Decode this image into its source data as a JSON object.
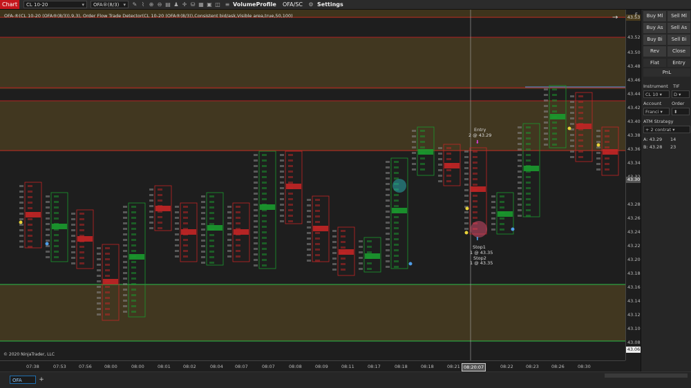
{
  "topbar": {
    "chart_tab": "Chart",
    "instrument": "CL 10-20",
    "period": "OFA®(8/3)",
    "volume_profile": "VolumeProfile",
    "ofa_sc": "OFA/SC",
    "settings": "Settings"
  },
  "chart": {
    "indicator_label": "OFA-®(CL 10-20 (OFA®(8/3)),9,3), Order Flow Trade Detector(CL 10-20 (OFA®(8/3)),Consistent bid/ask,Visible area,true,50,100)",
    "copyright": "© 2020 NinjaTrader, LLC",
    "entry_label": "Entry",
    "entry_value": "2 @ 43.29",
    "stop1_label": "Stop1",
    "stop1_value": "1 @ 43.35",
    "stop2_label": "Stop2",
    "stop2_value": "1 @ 43.35",
    "cursor_time": "08:20:07",
    "colors": {
      "bull": "#1a9b2e",
      "bear": "#c42525",
      "zone": "#4a3c1c",
      "zone_border": "#b22222",
      "green_line": "#2bbf4a",
      "blue_line": "#4f9de8"
    }
  },
  "price_axis": {
    "labels": [
      "43.52",
      "43.50",
      "43.48",
      "43.46",
      "43.44",
      "43.42",
      "43.40",
      "43.38",
      "43.36",
      "43.34",
      "43.32",
      "43.28",
      "43.26",
      "43.24",
      "43.22",
      "43.20",
      "43.18",
      "43.16",
      "43.14",
      "43.12",
      "43.10",
      "43.08"
    ],
    "current_price": "43.30",
    "top_price": "43.53",
    "bottom_price": "43.06"
  },
  "time_axis": {
    "labels": [
      "07:38",
      "07:53",
      "07:56",
      "08:00",
      "08:00",
      "08:01",
      "08:02",
      "08:04",
      "08:07",
      "08:07",
      "08:08",
      "08:09",
      "08:11",
      "08:17",
      "08:18",
      "08:18",
      "08:21",
      "08:22",
      "08:23",
      "08:26",
      "08:30"
    ]
  },
  "bottom": {
    "tab": "OFA",
    "add": "+"
  },
  "panel": {
    "buy_mkt": "Buy Ml",
    "sell_mkt": "Sell Ml",
    "buy_ask": "Buy As",
    "sell_ask": "Sell As",
    "buy_bid": "Buy Bi",
    "sell_bid": "Sell Bi",
    "rev": "Rev",
    "close": "Close",
    "flat": "Flat",
    "entry": "Entry",
    "pnl": "PnL",
    "instrument_label": "Instrument",
    "tif_label": "TIF",
    "instrument_value": "CL 10",
    "tif_value": "D",
    "account_label": "Account",
    "order_label": "Order",
    "account_value": "Franci",
    "atm_label": "ATM Strategy",
    "atm_value": "2 contrat",
    "ask_label": "A: 43.29",
    "ask_size": "14",
    "bid_label": "B: 43.28",
    "bid_size": "23",
    "f_label": "F"
  }
}
